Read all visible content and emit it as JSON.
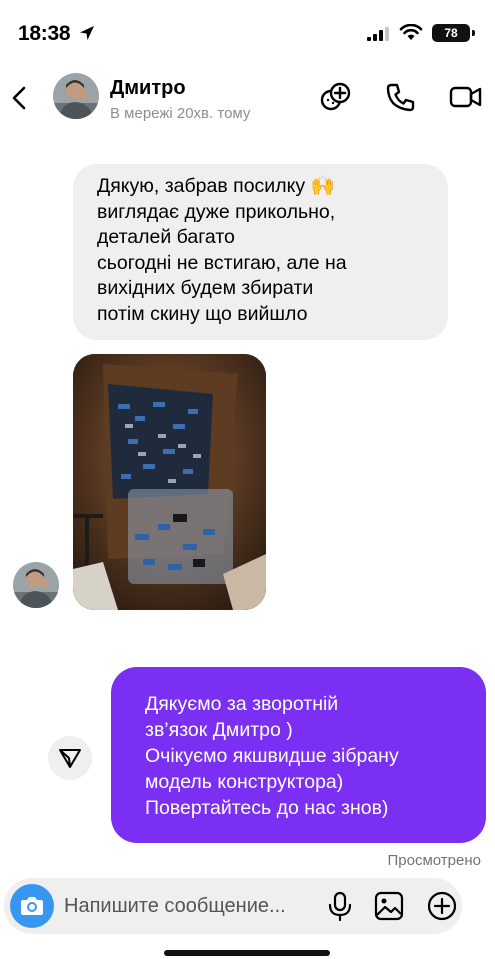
{
  "status_bar": {
    "time": "18:38",
    "battery": "78"
  },
  "header": {
    "contact_name": "Дмитро",
    "contact_status": "В мережі 20хв. тому",
    "icons": [
      "back-icon",
      "effects-icon",
      "phone-icon",
      "video-camera-icon"
    ]
  },
  "messages": {
    "incoming": {
      "lines": [
        "Дякую, забрав посилку 🙌",
        "виглядає дуже прикольно,",
        "деталей багато",
        "сьогодні не встигаю, але на",
        "вихідних будем збирати",
        "потім скину що вийшло"
      ]
    },
    "outgoing": {
      "lines": [
        "Дякуємо за зворотній",
        "зв’язок Дмитро )",
        "Очікуємо якшвидше зібрану",
        "модель конструктора)",
        "Повертайтесь до нас знов)"
      ],
      "status": "Просмотрено"
    }
  },
  "composer": {
    "placeholder": "Напишите сообщение...",
    "icons": [
      "camera-icon",
      "microphone-icon",
      "gallery-icon",
      "add-icon"
    ]
  },
  "colors": {
    "outgoing_bubble": "#7b2ff2",
    "incoming_bubble": "#efefef",
    "camera_button": "#3797f0",
    "secondary_text": "#8e8e8e"
  }
}
